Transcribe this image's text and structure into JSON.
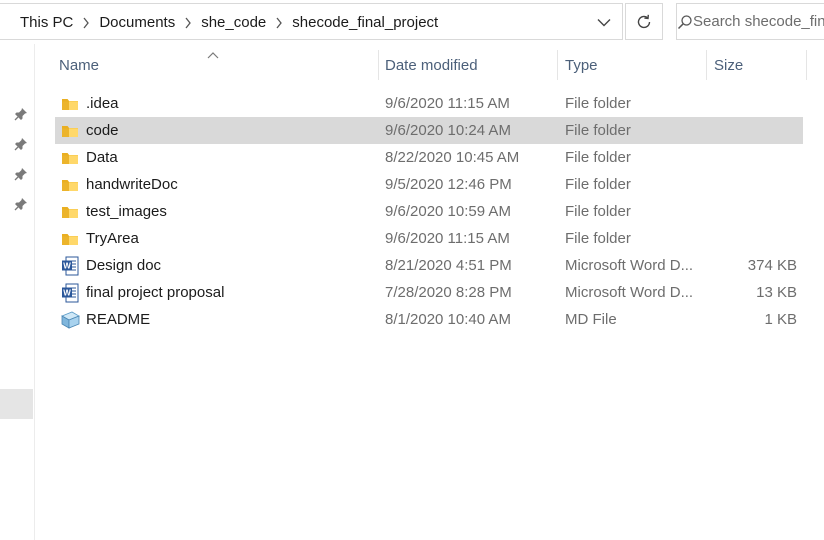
{
  "breadcrumb": {
    "items": [
      "This PC",
      "Documents",
      "she_code",
      "shecode_final_project"
    ]
  },
  "search": {
    "placeholder": "Search shecode_final_project"
  },
  "columns": {
    "name": "Name",
    "date": "Date modified",
    "type": "Type",
    "size": "Size"
  },
  "files": [
    {
      "name": ".idea",
      "date": "9/6/2020 11:15 AM",
      "type": "File folder",
      "size": "",
      "icon": "folder-icon",
      "selected": false
    },
    {
      "name": "code",
      "date": "9/6/2020 10:24 AM",
      "type": "File folder",
      "size": "",
      "icon": "folder-icon",
      "selected": true
    },
    {
      "name": "Data",
      "date": "8/22/2020 10:45 AM",
      "type": "File folder",
      "size": "",
      "icon": "folder-icon",
      "selected": false
    },
    {
      "name": "handwriteDoc",
      "date": "9/5/2020 12:46 PM",
      "type": "File folder",
      "size": "",
      "icon": "folder-icon",
      "selected": false
    },
    {
      "name": "test_images",
      "date": "9/6/2020 10:59 AM",
      "type": "File folder",
      "size": "",
      "icon": "folder-icon",
      "selected": false
    },
    {
      "name": "TryArea",
      "date": "9/6/2020 11:15 AM",
      "type": "File folder",
      "size": "",
      "icon": "folder-icon",
      "selected": false
    },
    {
      "name": "Design doc",
      "date": "8/21/2020 4:51 PM",
      "type": "Microsoft Word D...",
      "size": "374 KB",
      "icon": "word-document-icon",
      "selected": false
    },
    {
      "name": "final project proposal",
      "date": "7/28/2020 8:28 PM",
      "type": "Microsoft Word D...",
      "size": "13 KB",
      "icon": "word-document-icon",
      "selected": false
    },
    {
      "name": "README",
      "date": "8/1/2020 10:40 AM",
      "type": "MD File",
      "size": "1 KB",
      "icon": "md-file-icon",
      "selected": false
    }
  ],
  "colors": {
    "selection": "#d9d9d9",
    "folder": "#f5c342",
    "word": "#2b579a",
    "header_text": "#4c607a"
  }
}
